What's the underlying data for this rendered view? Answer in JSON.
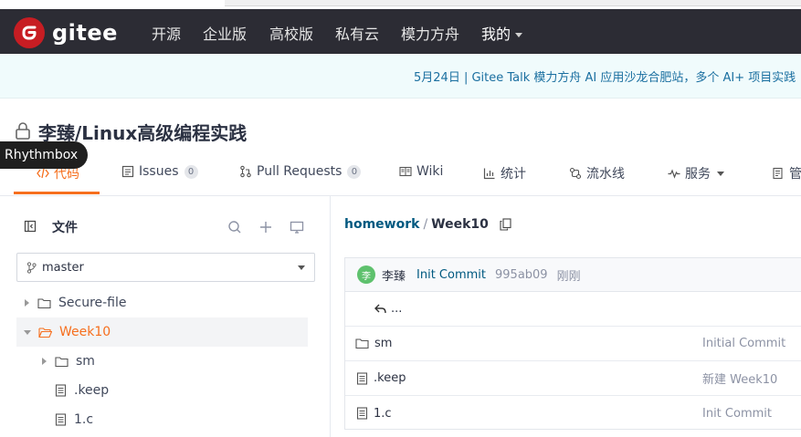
{
  "nav": {
    "brand": "gitee",
    "items": [
      "开源",
      "企业版",
      "高校版",
      "私有云",
      "模力方舟"
    ],
    "me": "我的"
  },
  "banner": {
    "text": "5月24日 | Gitee Talk 模力方舟 AI 应用沙龙合肥站，多个 AI+ 项目实践"
  },
  "repo": {
    "title": "李臻/Linux高级编程实践"
  },
  "tooltip": "Rhythmbox",
  "tabs": [
    {
      "label": "代码"
    },
    {
      "label": "Issues",
      "count": "0"
    },
    {
      "label": "Pull Requests",
      "count": "0"
    },
    {
      "label": "Wiki"
    },
    {
      "label": "统计"
    },
    {
      "label": "流水线"
    },
    {
      "label": "服务"
    },
    {
      "label": "管"
    }
  ],
  "sidebar": {
    "title": "文件",
    "branch": "master",
    "tree": [
      {
        "label": "Secure-file"
      },
      {
        "label": "Week10"
      },
      {
        "label": "sm"
      },
      {
        "label": ".keep"
      },
      {
        "label": "1.c"
      }
    ]
  },
  "main": {
    "breadcrumb_root": "homework",
    "breadcrumb_sep": "/",
    "breadcrumb_current": "Week10",
    "commit": {
      "avatar_text": "李",
      "author": "李臻",
      "message": "Init Commit",
      "hash": "995ab09",
      "time": "刚刚"
    },
    "parent_label": "...",
    "files": [
      {
        "name": "sm",
        "message": "Initial Commit"
      },
      {
        "name": ".keep",
        "message": "新建 Week10"
      },
      {
        "name": "1.c",
        "message": "Init Commit"
      }
    ]
  },
  "colors": {
    "nav_bg": "#2c2c34",
    "brand_red": "#c71d23",
    "accent_orange": "#f66f1e",
    "link_blue": "#005980"
  }
}
